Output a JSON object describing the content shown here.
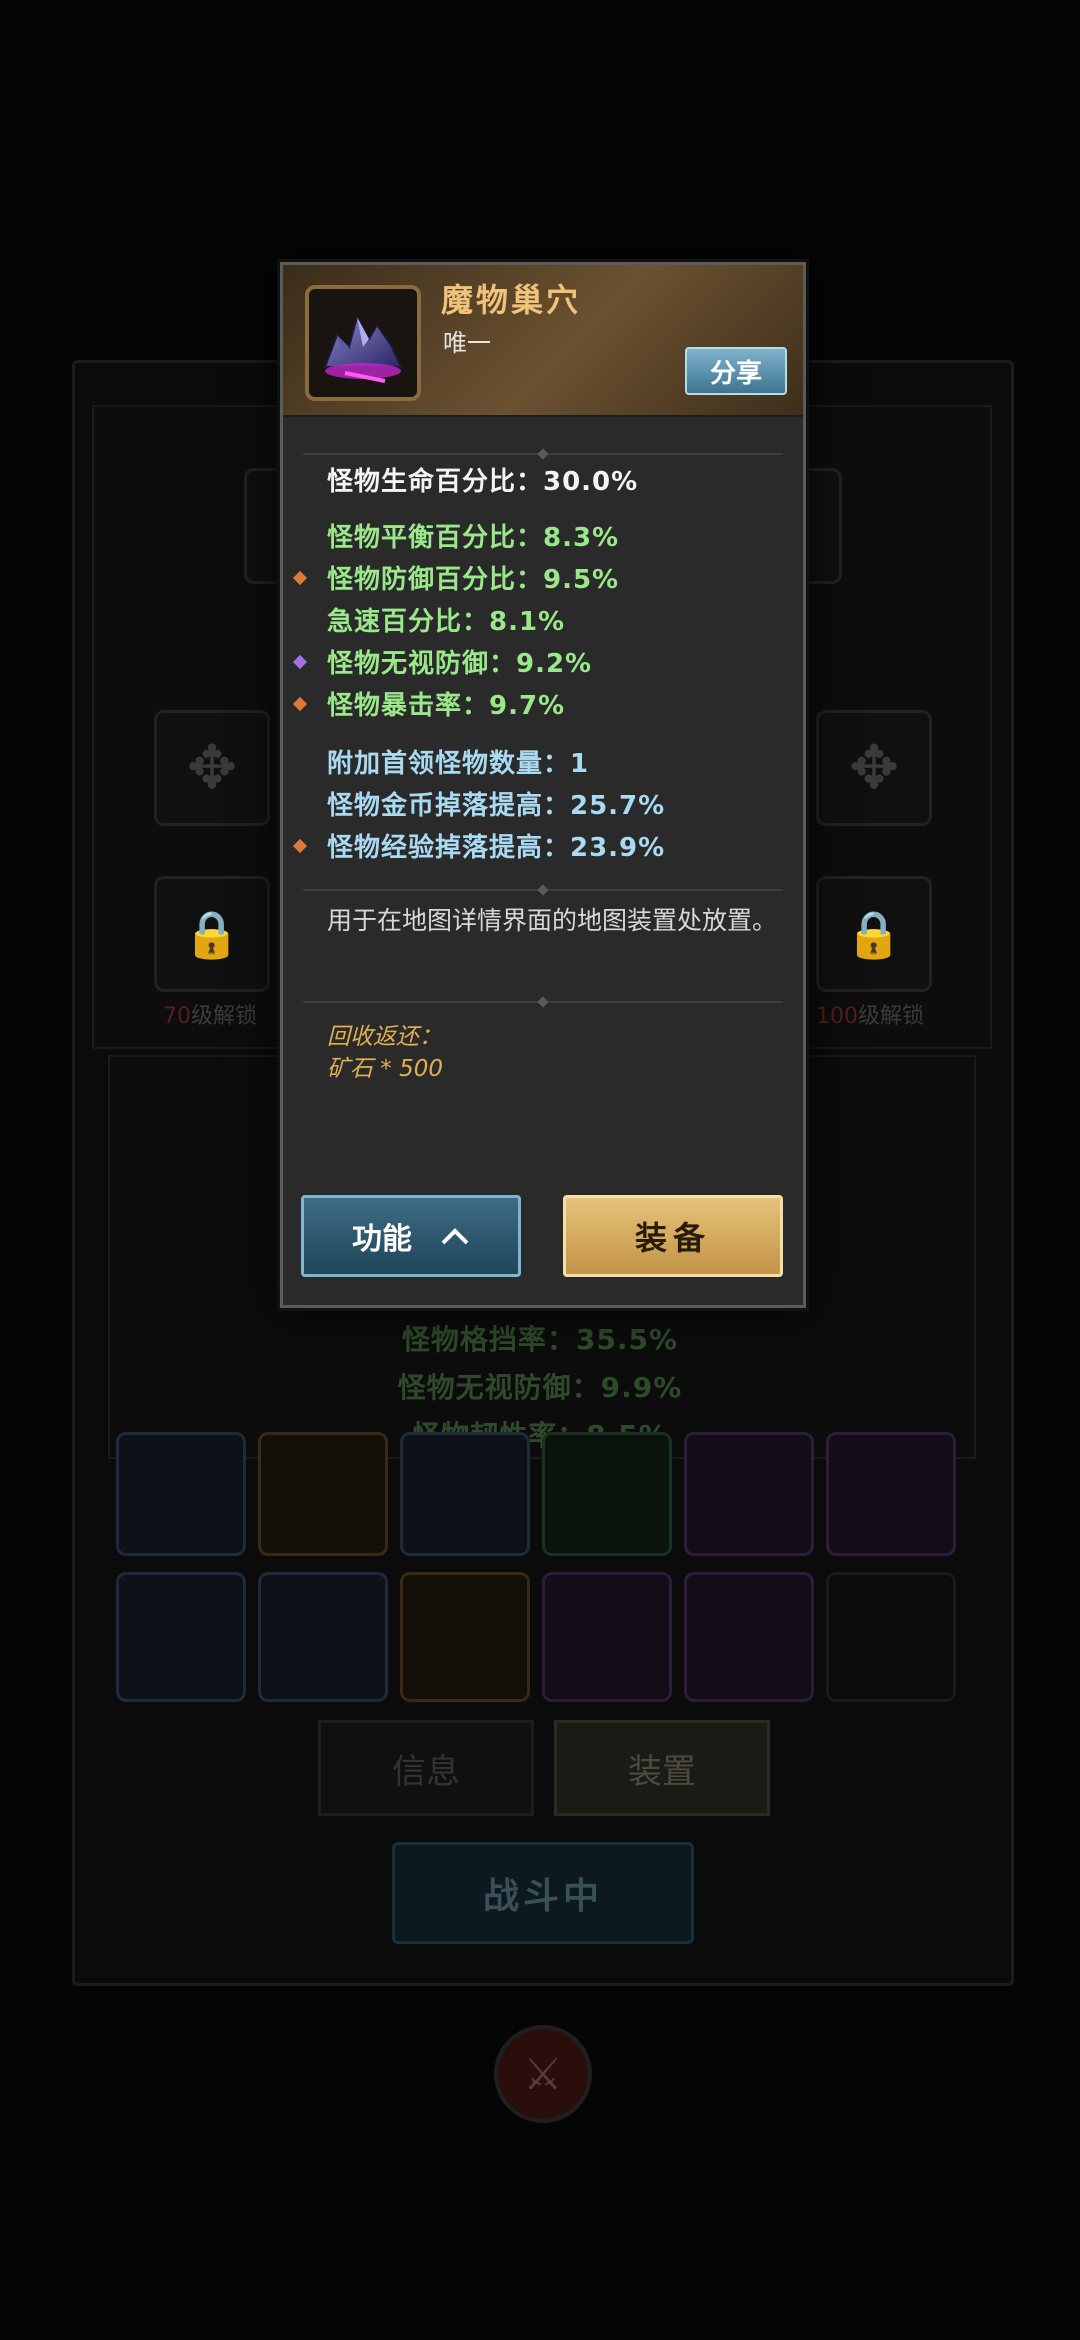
{
  "background": {
    "top_title": "",
    "left_lock_level": "70",
    "left_lock_suffix": "级解锁",
    "right_lock_level": "100",
    "right_lock_suffix": "级解锁",
    "stats": [
      "怪物格挡率：35.5%",
      "怪物无视防御：9.9%",
      "怪物韧性率：8.5%"
    ],
    "tabs": {
      "info": "信息",
      "device": "装置"
    },
    "battle_button": "战斗中"
  },
  "popup": {
    "item_name": "魔物巢穴",
    "rarity": "唯一",
    "share_label": "分享",
    "stats_main": [
      {
        "text": "怪物生命百分比：30.0%"
      }
    ],
    "stats_green": [
      {
        "text": "怪物平衡百分比：8.3%",
        "bullet": ""
      },
      {
        "text": "怪物防御百分比：9.5%",
        "bullet": "orange"
      },
      {
        "text": "急速百分比：8.1%",
        "bullet": ""
      },
      {
        "text": "怪物无视防御：9.2%",
        "bullet": "purple"
      },
      {
        "text": "怪物暴击率：9.7%",
        "bullet": "orange"
      }
    ],
    "stats_blue": [
      {
        "text": "附加首领怪物数量：1",
        "bullet": ""
      },
      {
        "text": "怪物金币掉落提高：25.7%",
        "bullet": ""
      },
      {
        "text": "怪物经验掉落提高：23.9%",
        "bullet": "orange"
      }
    ],
    "description": "用于在地图详情界面的地图装置处放置。",
    "recycle_title": "回收返还：",
    "recycle_value": "矿石 * 500",
    "function_button": "功能",
    "equip_button": "装备"
  },
  "colors": {
    "item_name": "#f1c27a",
    "green_stat": "#9be88a",
    "blue_stat": "#a9daf2",
    "recycle": "#e0b050",
    "equip_button": "#d9ad5f",
    "function_button": "#2f5a72"
  }
}
